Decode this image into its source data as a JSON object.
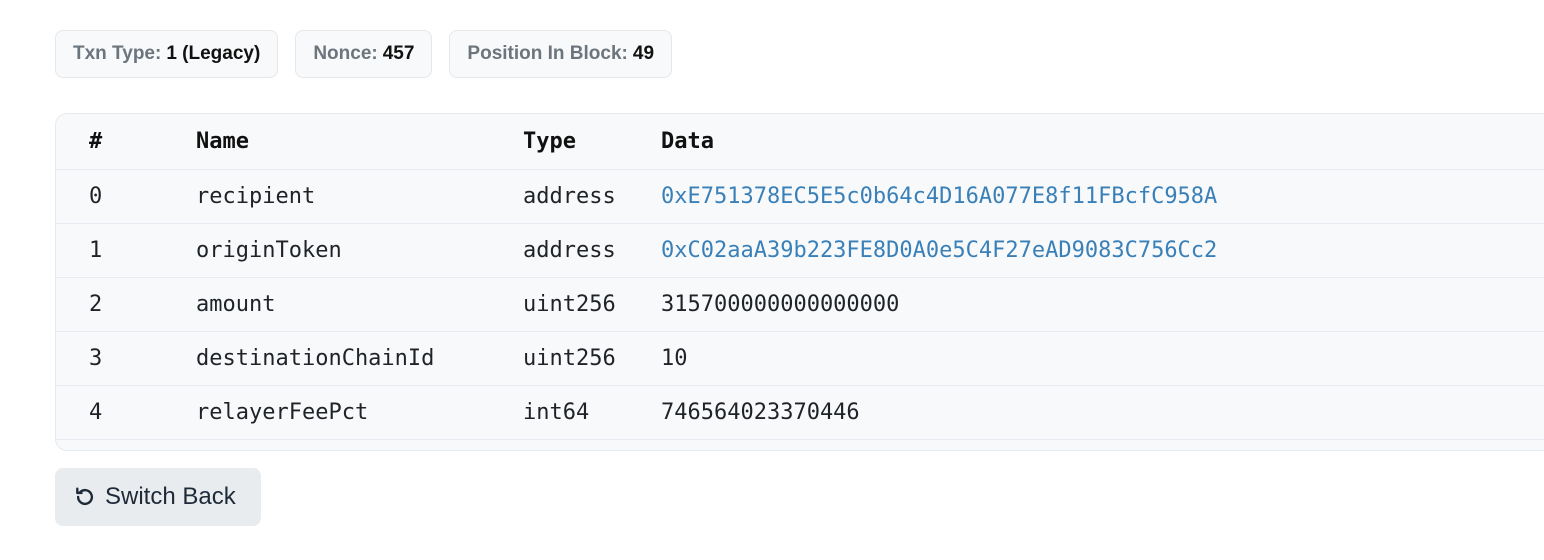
{
  "badges": [
    {
      "label": "Txn Type:",
      "value": "1 (Legacy)"
    },
    {
      "label": "Nonce:",
      "value": "457"
    },
    {
      "label": "Position In Block:",
      "value": "49"
    }
  ],
  "table": {
    "headers": {
      "index": "#",
      "name": "Name",
      "type": "Type",
      "data": "Data"
    },
    "rows": [
      {
        "index": "0",
        "name": "recipient",
        "type": "address",
        "data": "0xE751378EC5E5c0b64c4D16A077E8f11FBcfC958A"
      },
      {
        "index": "1",
        "name": "originToken",
        "type": "address",
        "data": "0xC02aaA39b223FE8D0A0e5C4F27eAD9083C756Cc2"
      },
      {
        "index": "2",
        "name": "amount",
        "type": "uint256",
        "data": "315700000000000000"
      },
      {
        "index": "3",
        "name": "destinationChainId",
        "type": "uint256",
        "data": "10"
      },
      {
        "index": "4",
        "name": "relayerFeePct",
        "type": "int64",
        "data": "746564023370446"
      }
    ]
  },
  "switch_back": {
    "label": "Switch Back",
    "icon": "undo-icon"
  },
  "colors": {
    "link": "#3a80b8",
    "badge_label": "#6c757d",
    "button_bg": "#e9ecef"
  }
}
